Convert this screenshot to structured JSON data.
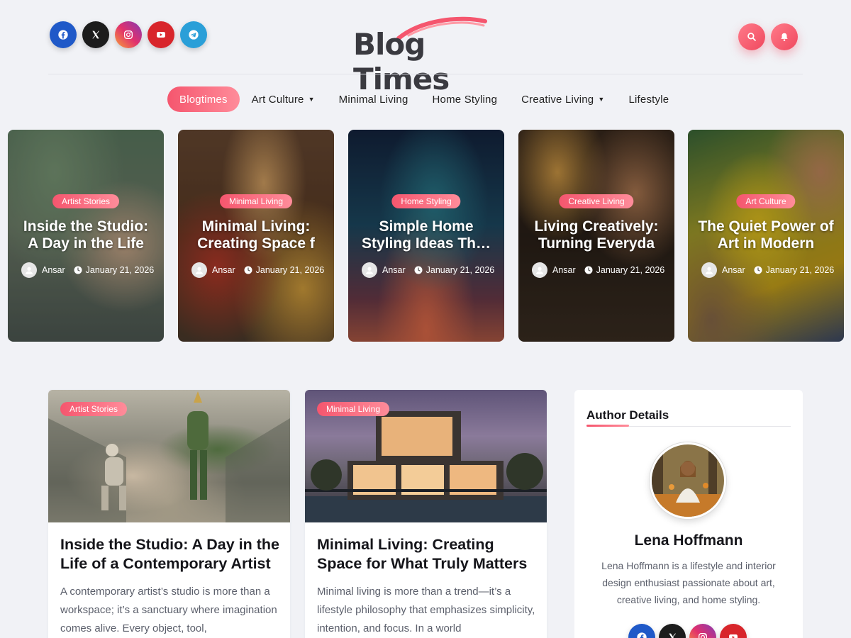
{
  "header": {
    "logo_text": "Blog Times",
    "social": [
      {
        "name": "facebook-icon",
        "color": "#1f59c8"
      },
      {
        "name": "x-icon",
        "color": "#1c1c1c"
      },
      {
        "name": "instagram-icon",
        "color": "#c13584"
      },
      {
        "name": "youtube-icon",
        "color": "#d8252b"
      },
      {
        "name": "telegram-icon",
        "color": "#2a9fd8"
      }
    ],
    "actions": [
      "search-icon",
      "bell-icon"
    ]
  },
  "nav": {
    "items": [
      {
        "label": "Blogtimes",
        "active": true,
        "dropdown": false
      },
      {
        "label": "Art Culture",
        "active": false,
        "dropdown": true
      },
      {
        "label": "Minimal Living",
        "active": false,
        "dropdown": false
      },
      {
        "label": "Home Styling",
        "active": false,
        "dropdown": false
      },
      {
        "label": "Creative Living",
        "active": false,
        "dropdown": true
      },
      {
        "label": "Lifestyle",
        "active": false,
        "dropdown": false
      }
    ]
  },
  "slider": {
    "slides": [
      {
        "category": "Artist Stories",
        "title": "Inside the Studio: A Day in the Life",
        "author": "Ansar",
        "date": "January 21, 2026"
      },
      {
        "category": "Minimal Living",
        "title": "Minimal Living: Creating Space f",
        "author": "Ansar",
        "date": "January 21, 2026"
      },
      {
        "category": "Home Styling",
        "title": "Simple Home Styling Ideas Th…",
        "author": "Ansar",
        "date": "January 21, 2026"
      },
      {
        "category": "Creative Living",
        "title": "Living Creatively: Turning Everyda",
        "author": "Ansar",
        "date": "January 21, 2026"
      },
      {
        "category": "Art Culture",
        "title": "The Quiet Power of Art in Modern",
        "author": "Ansar",
        "date": "January 21, 2026"
      }
    ]
  },
  "posts": [
    {
      "category": "Artist Stories",
      "title": "Inside the Studio: A Day in the Life of a Contemporary Artist",
      "excerpt": "A contemporary artist’s studio is more than a workspace; it’s a sanctuary where imagination comes alive. Every object, tool,"
    },
    {
      "category": "Minimal Living",
      "title": "Minimal Living: Creating Space for What Truly Matters",
      "excerpt": "Minimal living is more than a trend—it’s a lifestyle philosophy that emphasizes simplicity, intention, and focus. In a world"
    }
  ],
  "author_widget": {
    "title": "Author Details",
    "name": "Lena Hoffmann",
    "bio": "Lena Hoffmann is a lifestyle and interior design enthusiast passionate about art, creative living, and home styling.",
    "social": [
      "facebook-icon",
      "x-icon",
      "instagram-icon",
      "youtube-icon"
    ]
  },
  "colors": {
    "accent": "#f5566e",
    "accent_light": "#ff8c9a",
    "background": "#f1f2f6"
  }
}
